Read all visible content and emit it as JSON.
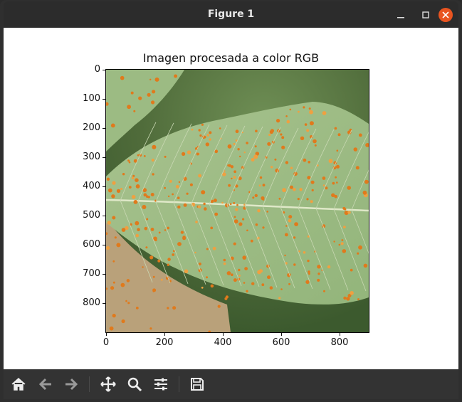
{
  "window": {
    "title": "Figure 1",
    "buttons": [
      "minimize",
      "maximize",
      "close"
    ]
  },
  "plot": {
    "title": "Imagen procesada a color RGB",
    "y_ticks": [
      "0",
      "100",
      "200",
      "300",
      "400",
      "500",
      "600",
      "700",
      "800"
    ],
    "x_ticks": [
      "0",
      "200",
      "400",
      "600",
      "800"
    ],
    "image_extent": {
      "x": [
        0,
        900
      ],
      "y": [
        900,
        0
      ]
    }
  },
  "toolbar": {
    "tools": [
      {
        "name": "home-icon",
        "tooltip": "Home"
      },
      {
        "name": "back-arrow-icon",
        "tooltip": "Back"
      },
      {
        "name": "forward-arrow-icon",
        "tooltip": "Forward"
      },
      {
        "name": "pan-icon",
        "tooltip": "Pan"
      },
      {
        "name": "zoom-icon",
        "tooltip": "Zoom"
      },
      {
        "name": "configure-subplots-icon",
        "tooltip": "Subplots"
      },
      {
        "name": "save-icon",
        "tooltip": "Save"
      }
    ]
  },
  "colors": {
    "titlebar": "#2c2c2c",
    "close_button": "#e95420",
    "toolbar": "#333333",
    "leaf_green": "#9fbf86",
    "rust_spots": "#e07a1c"
  }
}
